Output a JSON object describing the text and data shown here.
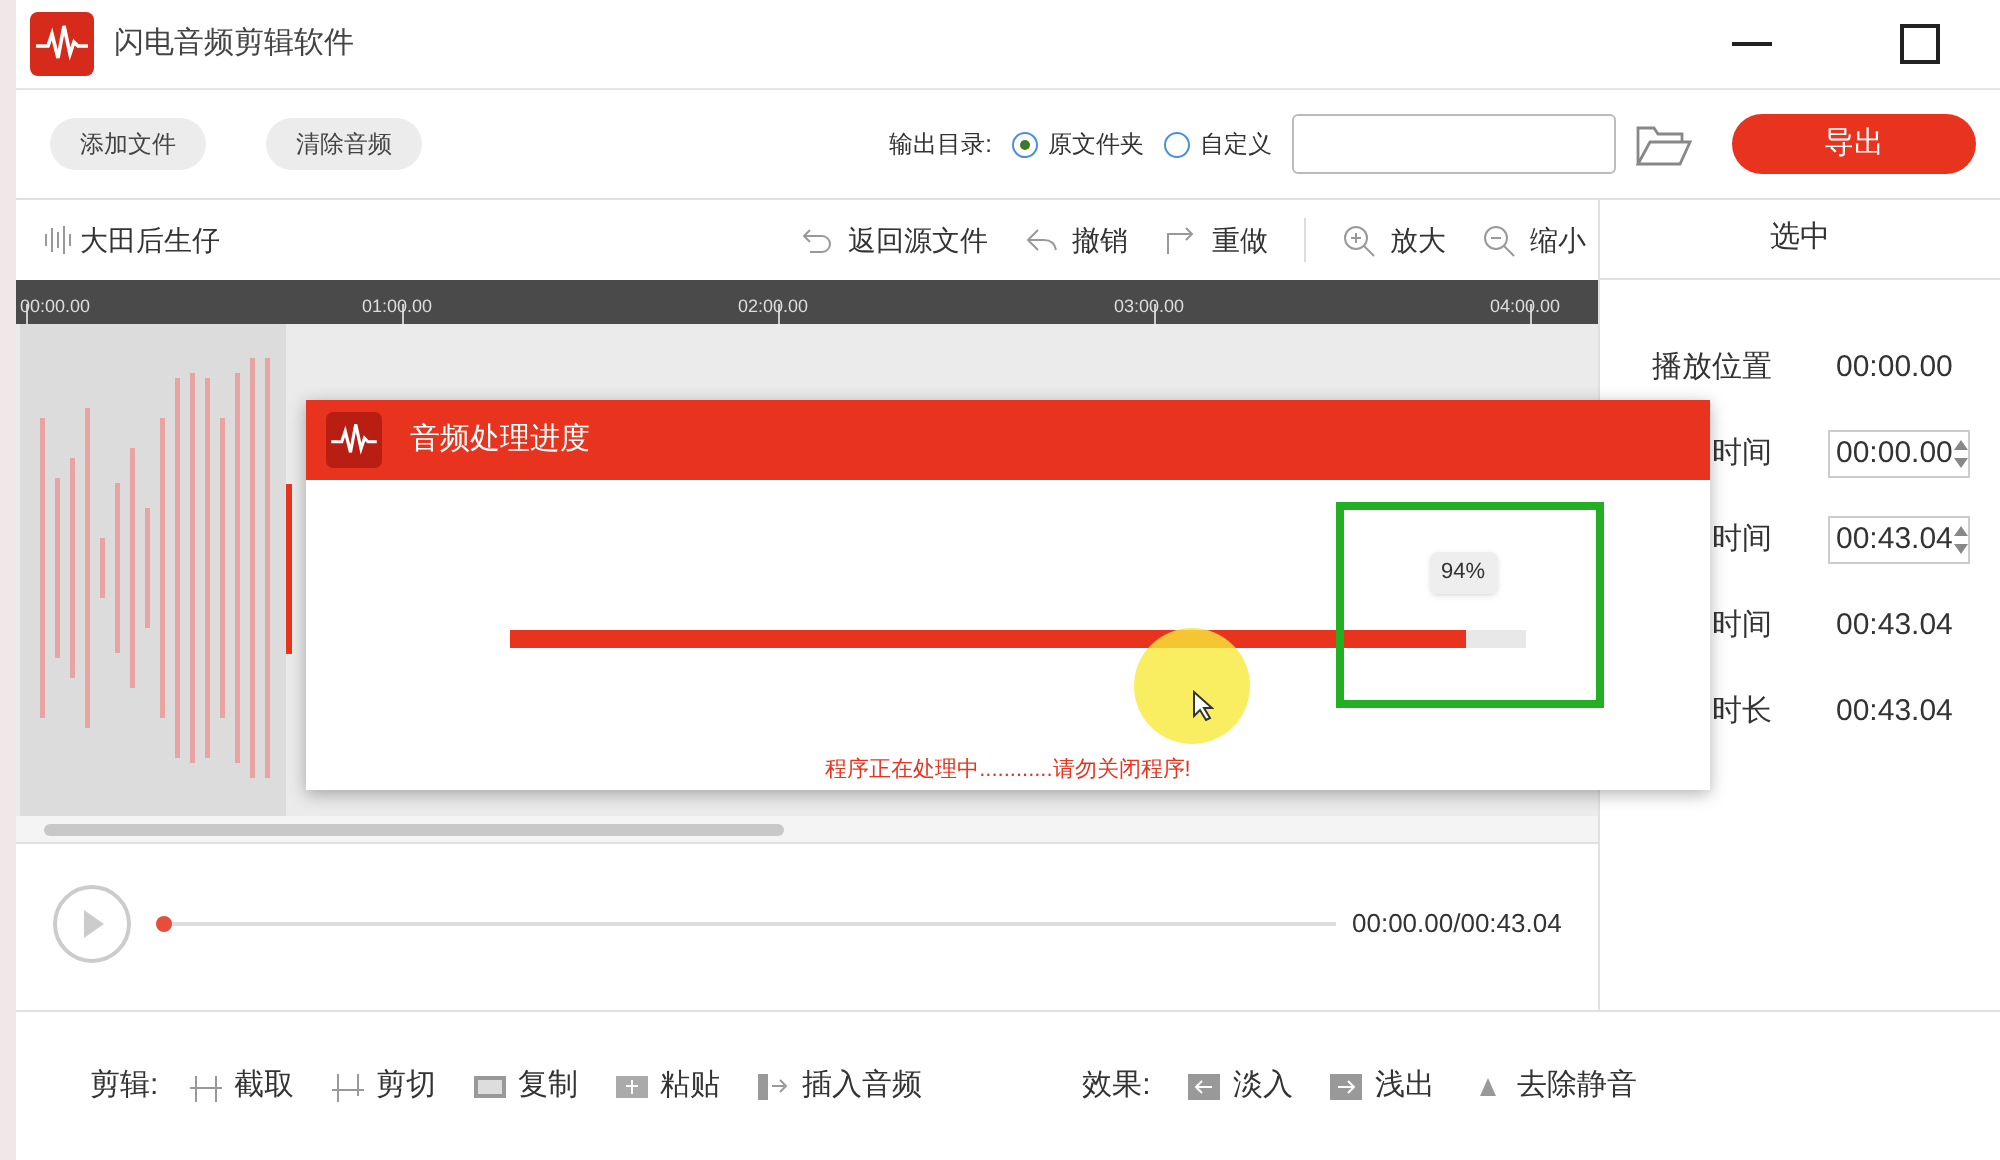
{
  "window": {
    "title": "闪电音频剪辑软件"
  },
  "toolbar": {
    "buttons": [
      "添加文件",
      "清除音频"
    ],
    "output_label": "输出目录:",
    "options": [
      {
        "label": "原文件夹",
        "selected": true
      },
      {
        "label": "自定义",
        "selected": false
      }
    ],
    "export": "导出"
  },
  "editor": {
    "track_name": "大田后生仔",
    "actions": [
      {
        "kind": "revert",
        "label": "返回源文件"
      },
      {
        "kind": "undo",
        "label": "撤销"
      },
      {
        "kind": "redo",
        "label": "重做"
      },
      {
        "kind": "zoom_in",
        "label": "放大"
      },
      {
        "kind": "zoom_out",
        "label": "缩小"
      }
    ],
    "ruler": [
      "00:00.00",
      "01:00.00",
      "02:00.00",
      "03:00.00",
      "04:00.00"
    ]
  },
  "side": {
    "title": "选中",
    "rows": [
      {
        "kind": "text",
        "label": "播放位置",
        "value": "00:00.00"
      },
      {
        "kind": "spin",
        "label": "时间",
        "value": "00:00.00"
      },
      {
        "kind": "spin",
        "label": "时间",
        "value": "00:43.04"
      },
      {
        "kind": "text",
        "label": "时间",
        "value": "00:43.04"
      },
      {
        "kind": "text",
        "label": "时长",
        "value": "00:43.04"
      }
    ]
  },
  "dialog": {
    "title": "音频处理进度",
    "level": 0.94,
    "percent": "94%",
    "message": "程序正在处理中............请勿关闭程序!"
  },
  "player": {
    "time": "00:00.00/00:43.04",
    "level": 0
  },
  "bottom": {
    "edit_label": "剪辑:",
    "edit_tools": [
      "截取",
      "剪切",
      "复制",
      "粘贴",
      "插入音频"
    ],
    "effect_label": "效果:",
    "effects": [
      "淡入",
      "浅出",
      "去除静音"
    ]
  }
}
